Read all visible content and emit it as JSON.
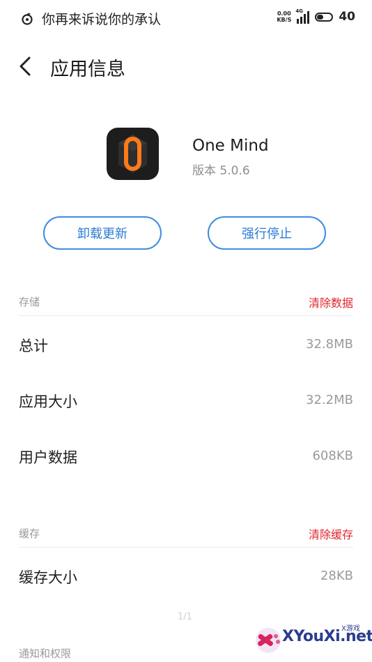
{
  "status_bar": {
    "now_playing": "你再来诉说你的承认",
    "net_speed_value": "0.00",
    "net_speed_unit": "KB/S",
    "network_type": "4G",
    "battery": "40"
  },
  "header": {
    "title": "应用信息"
  },
  "app": {
    "name": "One Mind",
    "version": "版本 5.0.6"
  },
  "buttons": {
    "uninstall_updates": "卸载更新",
    "force_stop": "强行停止"
  },
  "storage": {
    "label": "存储",
    "action": "清除数据",
    "rows": [
      {
        "label": "总计",
        "value": "32.8MB"
      },
      {
        "label": "应用大小",
        "value": "32.2MB"
      },
      {
        "label": "用户数据",
        "value": "608KB"
      }
    ]
  },
  "cache": {
    "label": "缓存",
    "action": "清除缓存",
    "rows": [
      {
        "label": "缓存大小",
        "value": "28KB"
      }
    ]
  },
  "notifications": {
    "label": "通知和权限"
  },
  "page_indicator": "1/1",
  "watermark": {
    "text": "XYouXi.net",
    "small": "X游戏"
  },
  "colors": {
    "accent_blue": "#2c7bd6",
    "danger_red": "#e0252b",
    "muted_gray": "#9a9a9a",
    "app_orange": "#ff7a1a"
  }
}
